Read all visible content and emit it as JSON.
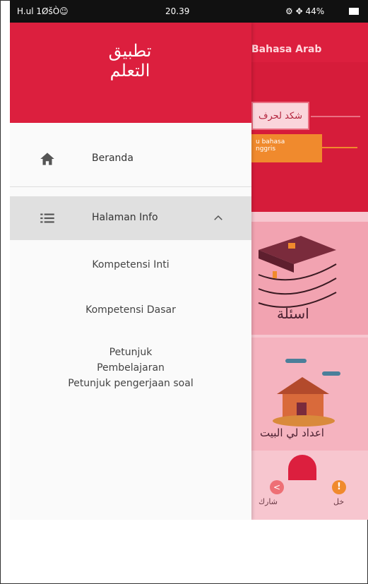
{
  "status_bar": {
    "left": "H.ul 1ØšÒ☺",
    "time": "20.39",
    "right": "⚙ ✥ 44%"
  },
  "background_app": {
    "title": "Bahasa Arab",
    "card_top_text": "شكد لحرف",
    "card_bottom_text": "u bahasa\nnggris",
    "tile1_label": "اسئلة",
    "tile2_label": "اعداد لي البيت",
    "share_label": "شارك",
    "info_label": "خل"
  },
  "drawer": {
    "header_title": "تطبيق التعلم",
    "items": [
      {
        "label": "Beranda",
        "icon": "home-icon"
      },
      {
        "label": "Halaman Info",
        "icon": "list-icon",
        "expanded": true
      }
    ],
    "sub_items": [
      "Kompetensi Inti",
      "Kompetensi Dasar",
      "Petunjuk Pembelajaran",
      "Petunjuk pengerjaan soal"
    ]
  },
  "colors": {
    "primary": "#dc1f3e",
    "accent": "#f08a2d",
    "drawer_bg": "#fafafa",
    "selected_bg": "#e0e0e0"
  }
}
